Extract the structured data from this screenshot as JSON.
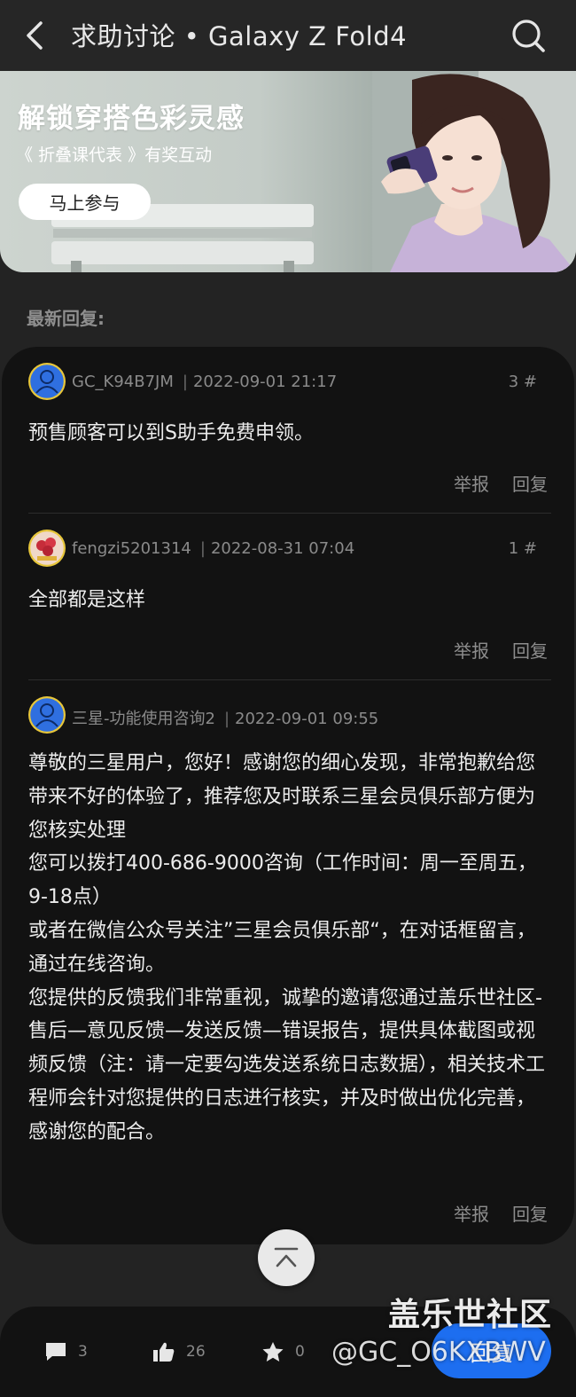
{
  "header": {
    "title": "求助讨论 • Galaxy Z Fold4",
    "back_icon": "chevron-left-icon",
    "search_icon": "search-icon"
  },
  "banner": {
    "title": "解锁穿搭色彩灵感",
    "subtitle": "《 折叠课代表 》有奖互动",
    "button_label": "马上参与"
  },
  "section_label": "最新回复:",
  "posts": [
    {
      "user": "GC_K94B7JM",
      "time": "2022-09-01 21:17",
      "floor": "3 #",
      "content": "预售顾客可以到S助手免费申领。",
      "report": "举报",
      "reply": "回复"
    },
    {
      "user": "fengzi5201314",
      "time": "2022-08-31 07:04",
      "floor": "1 #",
      "content": "全部都是这样",
      "report": "举报",
      "reply": "回复"
    },
    {
      "user": "三星-功能使用咨询2",
      "time": "2022-09-01 09:55",
      "floor": "",
      "content": "尊敬的三星用户，您好！感谢您的细心发现，非常抱歉给您带来不好的体验了，推荐您及时联系三星会员俱乐部方便为您核实处理\n您可以拨打400-686-9000咨询（工作时间：周一至周五，9-18点）\n或者在微信公众号关注”三星会员俱乐部“，在对话框留言，通过在线咨询。\n您提供的反馈我们非常重视，诚挚的邀请您通过盖乐世社区-售后—意见反馈—发送反馈—错误报告，提供具体截图或视频反馈（注：请一定要勾选发送系统日志数据），相关技术工程师会针对您提供的日志进行核实，并及时做出优化完善，感谢您的配合。",
      "report": "举报",
      "reply": "回复"
    }
  ],
  "bottom_bar": {
    "comments": "3",
    "likes": "26",
    "favorites": "0",
    "reply_label": "回复"
  },
  "watermark": {
    "line1": "盖乐世社区",
    "line2": "@GC_O6KXBWV"
  },
  "colors": {
    "accent": "#1d6ef0",
    "card_bg": "#121212",
    "page_bg": "#232323"
  }
}
